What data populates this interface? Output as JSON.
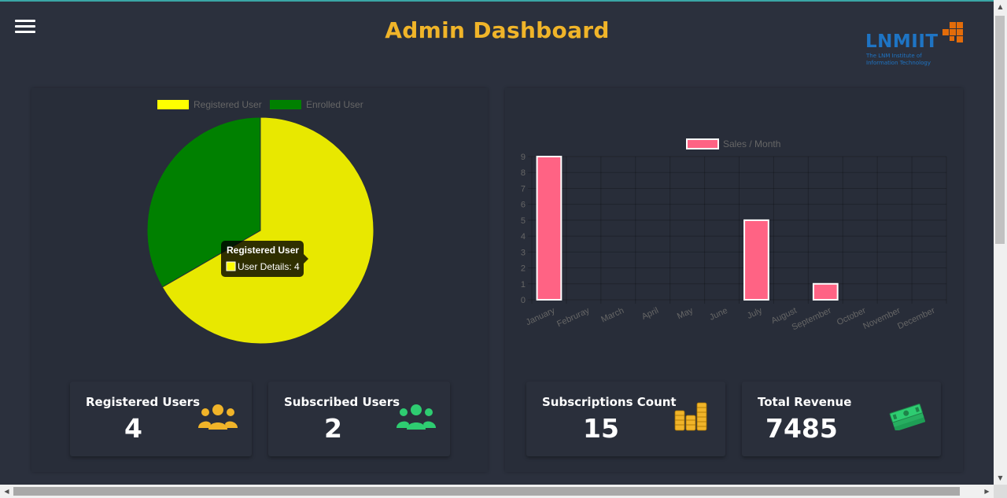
{
  "header": {
    "title": "Admin Dashboard",
    "menu_icon": "hamburger-menu-icon",
    "logo_text": "LNMIIT",
    "logo_subtitle": "The LNM Institute of\nInformation Technology"
  },
  "pie_chart": {
    "chart_data": {
      "type": "pie",
      "labels": [
        "Registered User",
        "Enrolled User"
      ],
      "values": [
        4,
        2
      ],
      "colors": [
        "#e8e800",
        "#008000"
      ],
      "legend_swatch_colors": [
        "#ffff00",
        "#008000"
      ],
      "legend_position": "top"
    },
    "tooltip": {
      "title": "Registered User",
      "body": "User Details: 4"
    }
  },
  "bar_chart": {
    "chart_data": {
      "type": "bar",
      "categories": [
        "January",
        "Februray",
        "March",
        "April",
        "May",
        "June",
        "July",
        "August",
        "September",
        "October",
        "November",
        "December"
      ],
      "series": [
        {
          "name": "Sales / Month",
          "values": [
            9,
            0,
            0,
            0,
            0,
            0,
            5,
            0,
            1,
            0,
            0,
            0
          ]
        }
      ],
      "ylim": [
        0,
        9
      ],
      "yticks": [
        "0",
        "1",
        "2",
        "3",
        "4",
        "5",
        "6",
        "7",
        "8",
        "9"
      ],
      "grid": true,
      "legend_position": "top",
      "bar_color": "#ff6384"
    }
  },
  "cards": [
    {
      "label": "Registered Users",
      "value": "4",
      "icon": "users-group-icon",
      "icon_color": "#f0b429"
    },
    {
      "label": "Subscribed Users",
      "value": "2",
      "icon": "users-group-icon",
      "icon_color": "#2ecc71"
    },
    {
      "label": "Subscriptions Count",
      "value": "15",
      "icon": "coin-stacks-icon",
      "icon_color": "#f0b429"
    },
    {
      "label": "Total Revenue",
      "value": "7485",
      "icon": "money-stack-icon",
      "icon_color": "#2ecc71"
    }
  ]
}
